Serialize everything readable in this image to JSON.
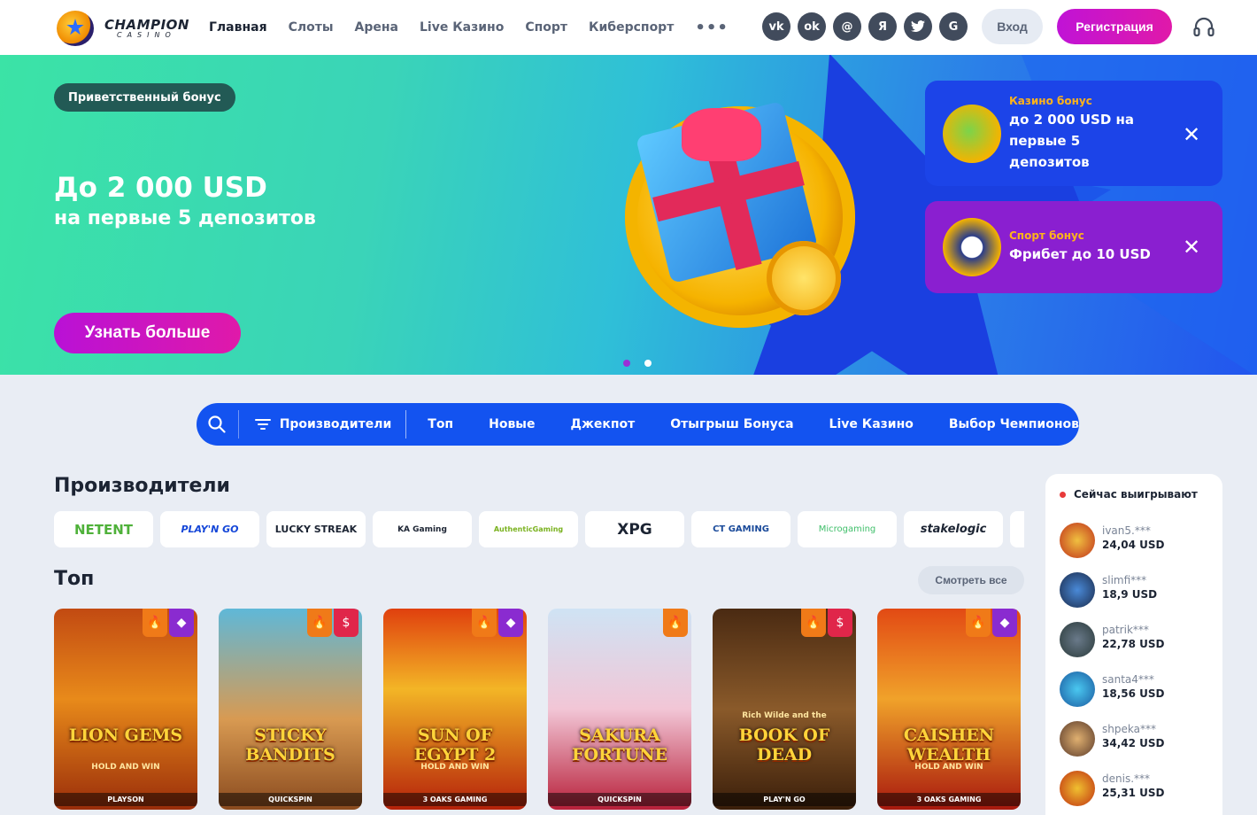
{
  "brand": {
    "name": "CHAMPION",
    "sub": "CASINO"
  },
  "nav": [
    "Главная",
    "Слоты",
    "Арена",
    "Live Казино",
    "Спорт",
    "Киберспорт"
  ],
  "nav_more": "•••",
  "social": [
    "vk",
    "ok",
    "@",
    "Я",
    "twitter",
    "G"
  ],
  "auth": {
    "login": "Вход",
    "register": "Регистрация"
  },
  "hero": {
    "badge": "Приветственный бонус",
    "title": "До 2 000 USD",
    "subtitle": "на первые 5 депозитов",
    "cta": "Узнать больше"
  },
  "promos": [
    {
      "label": "Казино бонус",
      "text": "до 2 000 USD на первые 5 депозитов"
    },
    {
      "label": "Спорт бонус",
      "text": "Фрибет до 10 USD"
    }
  ],
  "categories": {
    "providers": "Производители",
    "items": [
      "Топ",
      "Новые",
      "Джекпот",
      "Отыгрыш Бонуса",
      "Live Казино",
      "Выбор Чемпионов"
    ]
  },
  "providers_section": {
    "title": "Производители",
    "list": [
      "NETENT",
      "PLAY'N GO",
      "LUCKY STREAK",
      "KA Gaming",
      "AuthenticGaming",
      "XPG",
      "CT GAMING",
      "Microgaming",
      "stakelogic"
    ]
  },
  "top_section": {
    "title": "Топ",
    "see_all": "Смотреть все"
  },
  "games": [
    {
      "name": "LION GEMS",
      "sub": "HOLD AND WIN",
      "provider": "PLAYSON"
    },
    {
      "name": "STICKY BANDITS",
      "sub": "",
      "provider": "QUICKSPIN"
    },
    {
      "name": "SUN OF EGYPT 2",
      "sub": "HOLD AND WIN",
      "provider": "3 OAKS GAMING"
    },
    {
      "name": "SAKURA FORTUNE",
      "sub": "",
      "provider": "QUICKSPIN"
    },
    {
      "name": "BOOK OF DEAD",
      "sub": "Rich Wilde and the",
      "provider": "PLAY'N GO"
    },
    {
      "name": "CAISHEN WEALTH",
      "sub": "HOLD AND WIN",
      "provider": "3 OAKS GAMING"
    }
  ],
  "winners": {
    "title": "Сейчас выигрывают",
    "list": [
      {
        "user": "ivan5.***",
        "amount": "24,04 USD"
      },
      {
        "user": "slimfi***",
        "amount": "18,9 USD"
      },
      {
        "user": "patrik***",
        "amount": "22,78 USD"
      },
      {
        "user": "santa4***",
        "amount": "18,56 USD"
      },
      {
        "user": "shpeka***",
        "amount": "34,42 USD"
      },
      {
        "user": "denis.***",
        "amount": "25,31 USD"
      }
    ]
  }
}
